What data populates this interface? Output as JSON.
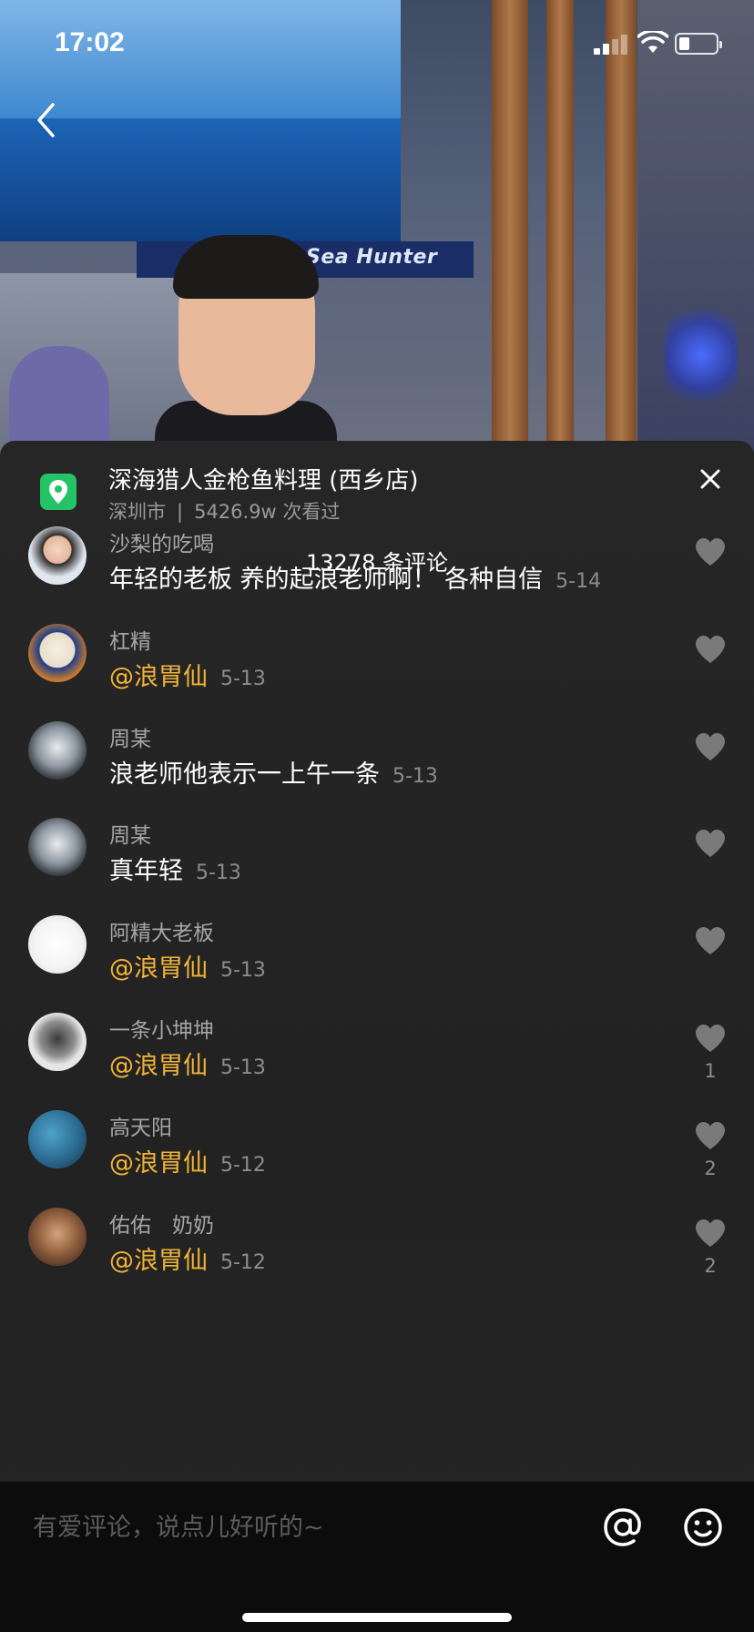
{
  "status_bar": {
    "time": "17:02",
    "battery_level": 0.3
  },
  "video": {
    "brand_text": "Sea Hunter"
  },
  "location": {
    "name": "深海猎人金枪鱼料理 (西乡店)",
    "city": "深圳市",
    "separator": "|",
    "views": "5426.9w 次看过"
  },
  "comments_header": {
    "count_label": "13278 条评论"
  },
  "comments": [
    {
      "user": "沙梨的吃喝",
      "text": "年轻的老板 养的起浪老师啊！ 各种自信",
      "mention": "",
      "date": "5-14",
      "likes": ""
    },
    {
      "user": "杠精",
      "text": "",
      "mention": "@浪胃仙",
      "date": "5-13",
      "likes": ""
    },
    {
      "user": "周某",
      "text": "浪老师他表示一上午一条",
      "mention": "",
      "date": "5-13",
      "likes": ""
    },
    {
      "user": "周某",
      "text": "真年轻",
      "mention": "",
      "date": "5-13",
      "likes": ""
    },
    {
      "user": "阿精大老板",
      "text": "",
      "mention": "@浪胃仙",
      "date": "5-13",
      "likes": ""
    },
    {
      "user": "一条小坤坤",
      "text": "",
      "mention": "@浪胃仙",
      "date": "5-13",
      "likes": "1"
    },
    {
      "user": "高天阳",
      "text": "",
      "mention": "@浪胃仙",
      "date": "5-12",
      "likes": "2"
    },
    {
      "user": "佑佑　奶奶",
      "text": "",
      "mention": "@浪胃仙",
      "date": "5-12",
      "likes": "2"
    }
  ],
  "input": {
    "placeholder": "有爱评论，说点儿好听的~",
    "value": ""
  },
  "icons": {
    "back": "chevron-left-icon",
    "close": "close-icon",
    "location": "location-pin-icon",
    "like": "heart-icon",
    "at": "at-sign-icon",
    "emoji": "smiley-icon"
  },
  "colors": {
    "mention": "#f2b437",
    "location_icon_bg": "#25c367",
    "sheet_bg": "#242424"
  }
}
